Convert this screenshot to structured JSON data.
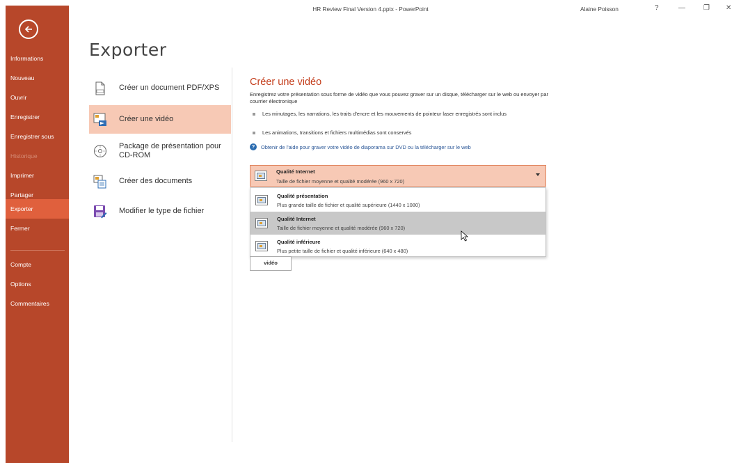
{
  "window": {
    "title": "HR Review Final Version 4.pptx - PowerPoint",
    "user": "Alaine Poisson",
    "controls": {
      "help": "?",
      "minimize": "—",
      "restore": "❐",
      "close": "✕"
    }
  },
  "nav": {
    "back_icon": "back-arrow-icon",
    "items": [
      {
        "label": "Informations"
      },
      {
        "label": "Nouveau"
      },
      {
        "label": "Ouvrir"
      },
      {
        "label": "Enregistrer"
      },
      {
        "label": "Enregistrer sous"
      },
      {
        "label": "Historique"
      },
      {
        "label": "Imprimer"
      },
      {
        "label": "Partager"
      },
      {
        "label": "Exporter"
      },
      {
        "label": "Fermer"
      },
      {
        "label": "Compte"
      },
      {
        "label": "Options"
      },
      {
        "label": "Commentaires"
      }
    ],
    "active": "Exporter",
    "disabled": "Historique"
  },
  "page_title": "Exporter",
  "options": [
    {
      "label": "Créer un document PDF/XPS",
      "icon": "pdf-document-icon"
    },
    {
      "label": "Créer une vidéo",
      "icon": "video-icon"
    },
    {
      "label": "Package de présentation pour CD-ROM",
      "icon": "cd-icon"
    },
    {
      "label": "Créer des documents",
      "icon": "handouts-icon"
    },
    {
      "label": "Modifier le type de fichier",
      "icon": "file-type-icon"
    }
  ],
  "video": {
    "title": "Créer une vidéo",
    "description": "Enregistrez votre présentation sous forme de vidéo que vous pouvez graver sur un disque, télécharger sur le web ou envoyer par courrier électronique",
    "bullets": [
      "Les minutages, les narrations, les traits d'encre et les mouvements de pointeur laser enregistrés sont inclus",
      "Les animations, transitions et fichiers multimédias sont conservés"
    ],
    "help_link": "Obtenir de l'aide pour graver votre vidéo de diaporama sur DVD ou la télécharger sur le web",
    "selected_quality": {
      "title": "Qualité Internet",
      "subtitle": "Taille de fichier moyenne et qualité modérée (960 x 720)"
    },
    "quality_options": [
      {
        "title": "Qualité présentation",
        "subtitle": "Plus grande taille de fichier et qualité supérieure (1440 x 1080)"
      },
      {
        "title": "Qualité Internet",
        "subtitle": "Taille de fichier moyenne et qualité modérée (960 x 720)"
      },
      {
        "title": "Qualité inférieure",
        "subtitle": "Plus petite taille de fichier et qualité inférieure (640 x 480)"
      }
    ],
    "create_button": "vidéo"
  },
  "colors": {
    "nav_bg": "#b7472a",
    "nav_active": "#e0603d",
    "accent_text": "#c43e1c",
    "selected_bg": "#f7c9b5"
  }
}
